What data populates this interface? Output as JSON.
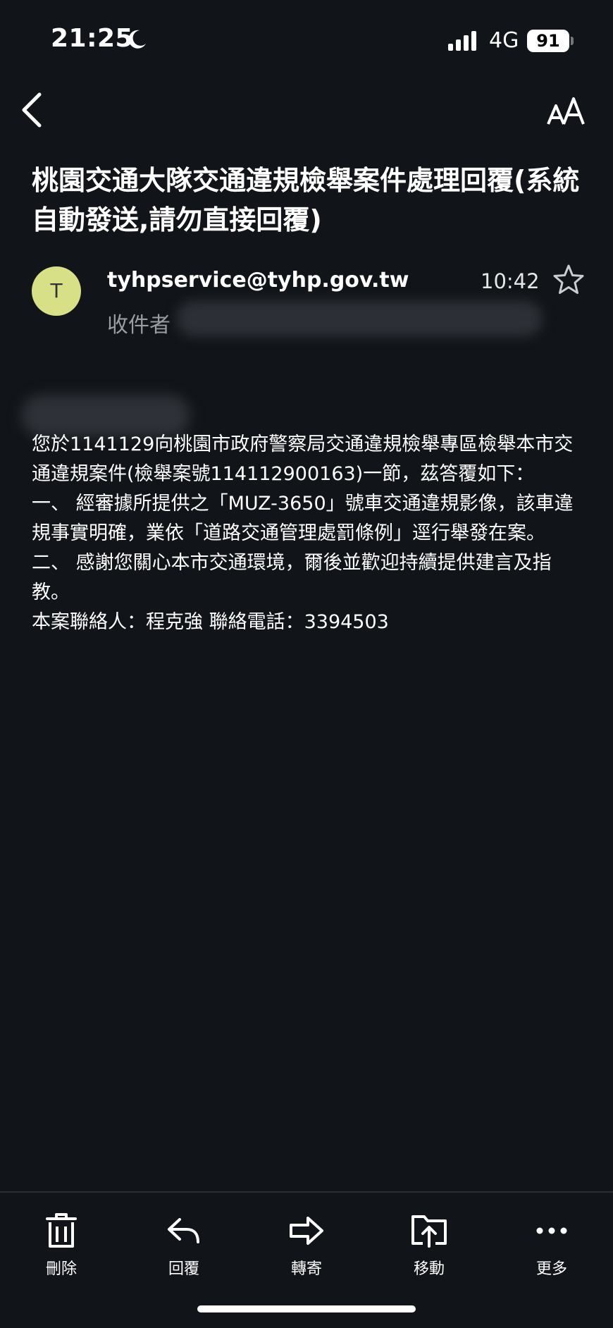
{
  "status_bar": {
    "time": "21:25",
    "network": "4G",
    "battery": "91"
  },
  "icons": {
    "back": "chevron-left-icon",
    "text_size": "text-size-icon",
    "star": "star-outline-icon",
    "delete": "trash-icon",
    "reply": "reply-icon",
    "forward": "forward-icon",
    "move": "folder-move-icon",
    "more": "more-dots-icon"
  },
  "email": {
    "subject": "桃園交通大隊交通違規檢舉案件處理回覆(系統自動發送,請勿直接回覆)",
    "sender_initial": "T",
    "sender_email": "tyhpservice@tyhp.gov.tw",
    "time": "10:42",
    "recipient_label": "收件者",
    "body": [
      "您於1141129向桃園市政府警察局交通違規檢舉專區檢舉本市交通違規案件(檢舉案號114112900163)一節，茲答覆如下：",
      "一、 經審據所提供之「MUZ-3650」號車交通違規影像，該車違規事實明確，業依「道路交通管理處罰條例」逕行舉發在案。",
      "二、 感謝您關心本市交通環境，爾後並歡迎持續提供建言及指教。",
      "本案聯絡人：程克強 聯絡電話：3394503"
    ]
  },
  "toolbar": {
    "delete_label": "刪除",
    "reply_label": "回覆",
    "forward_label": "轉寄",
    "move_label": "移動",
    "more_label": "更多"
  },
  "colors": {
    "background": "#111418",
    "avatar": "#d7e086",
    "secondary_text": "#9a9ea3"
  }
}
